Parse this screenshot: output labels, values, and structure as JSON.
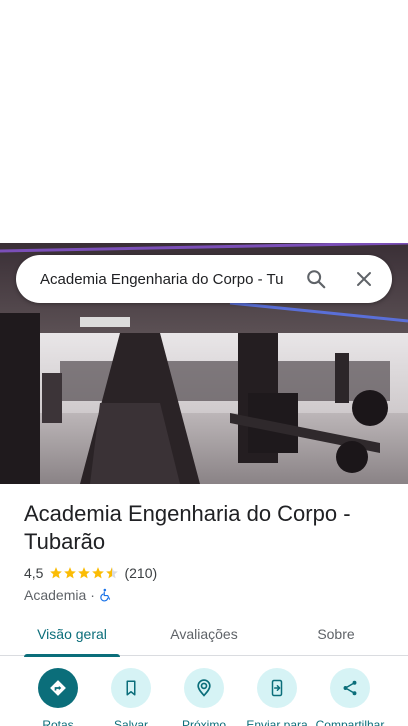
{
  "search": {
    "query": "Academia Engenharia do Corpo - Tu"
  },
  "place": {
    "name": "Academia Engenharia do Corpo - Tubarão",
    "rating": "4,5",
    "rating_value": 4.5,
    "review_count": "(210)",
    "category": "Academia",
    "separator": "·"
  },
  "tabs": [
    {
      "label": "Visão geral",
      "active": true
    },
    {
      "label": "Avaliações",
      "active": false
    },
    {
      "label": "Sobre",
      "active": false
    }
  ],
  "actions": [
    {
      "label": "Rotas",
      "icon": "directions-icon"
    },
    {
      "label": "Salvar",
      "icon": "bookmark-icon"
    },
    {
      "label": "Próximo",
      "icon": "nearby-icon"
    },
    {
      "label": "Enviar para",
      "icon": "send-to-phone-icon"
    },
    {
      "label": "Compartilhar",
      "icon": "share-icon"
    }
  ],
  "colors": {
    "accent": "#0b6e7a",
    "accent_light": "#d6f3f5",
    "star": "#fbbc04",
    "accessibility": "#1a73e8"
  }
}
